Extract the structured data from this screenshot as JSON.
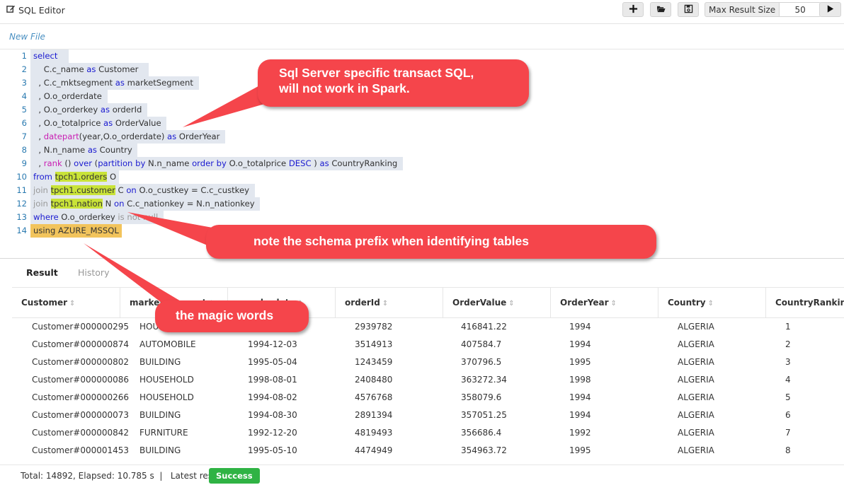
{
  "toolbar": {
    "title": "SQL Editor",
    "max_result_label": "Max Result Size",
    "max_result_value": "50",
    "icons": [
      "edit-icon",
      "plus-icon",
      "folder-open-icon",
      "save-icon",
      "play-icon"
    ]
  },
  "file_tab": {
    "label": "New File"
  },
  "editor": {
    "line_numbers": [
      "1",
      "2",
      "3",
      "4",
      "5",
      "6",
      "7",
      "8",
      "9",
      "10",
      "11",
      "12",
      "13",
      "14"
    ],
    "lines": [
      "select",
      "    C.c_name as Customer",
      "  , C.c_mktsegment as marketSegment",
      "  , O.o_orderdate",
      "  , O.o_orderkey as orderId",
      "  , O.o_totalprice as OrderValue",
      "  , datepart(year,O.o_orderdate) as OrderYear",
      "  , N.n_name as Country",
      "  , rank () over (partition by N.n_name order by O.o_totalprice DESC ) as CountryRanking",
      "from tpch1.orders O",
      "join tpch1.customer C on O.o_custkey = C.c_custkey",
      "join tpch1.nation N on C.c_nationkey = N.n_nationkey",
      "where O.o_orderkey is not null",
      "using AZURE_MSSQL"
    ]
  },
  "results": {
    "tabs": [
      "Result",
      "History"
    ],
    "columns": [
      "Customer",
      "marketSegment",
      "o_orderdate",
      "orderId",
      "OrderValue",
      "OrderYear",
      "Country",
      "CountryRanking"
    ],
    "rows": [
      [
        "Customer#000000295",
        "HOUSEHOLD",
        "",
        "2939782",
        "416841.22",
        "1994",
        "ALGERIA",
        "1"
      ],
      [
        "Customer#000000874",
        "AUTOMOBILE",
        "1994-12-03",
        "3514913",
        "407584.7",
        "1994",
        "ALGERIA",
        "2"
      ],
      [
        "Customer#000000802",
        "BUILDING",
        "1995-05-04",
        "1243459",
        "370796.5",
        "1995",
        "ALGERIA",
        "3"
      ],
      [
        "Customer#000000086",
        "HOUSEHOLD",
        "1998-08-01",
        "2408480",
        "363272.34",
        "1998",
        "ALGERIA",
        "4"
      ],
      [
        "Customer#000000266",
        "HOUSEHOLD",
        "1994-08-02",
        "4576768",
        "358079.6",
        "1994",
        "ALGERIA",
        "5"
      ],
      [
        "Customer#000000073",
        "BUILDING",
        "1994-08-30",
        "2891394",
        "357051.25",
        "1994",
        "ALGERIA",
        "6"
      ],
      [
        "Customer#000000842",
        "FURNITURE",
        "1992-12-20",
        "4819493",
        "356686.4",
        "1992",
        "ALGERIA",
        "7"
      ],
      [
        "Customer#000001453",
        "BUILDING",
        "1995-05-10",
        "4474949",
        "354963.72",
        "1995",
        "ALGERIA",
        "8"
      ]
    ]
  },
  "footer": {
    "summary": "Total: 14892, Elapsed: 10.785 s  |   Latest result:",
    "status": "Success",
    "status_color": "#2fb344"
  },
  "callouts": {
    "first": [
      "Sql Server specific transact SQL,",
      "will not work in Spark."
    ],
    "second": "note the schema prefix when identifying tables",
    "third": "the magic words",
    "color": "#f5454b"
  }
}
